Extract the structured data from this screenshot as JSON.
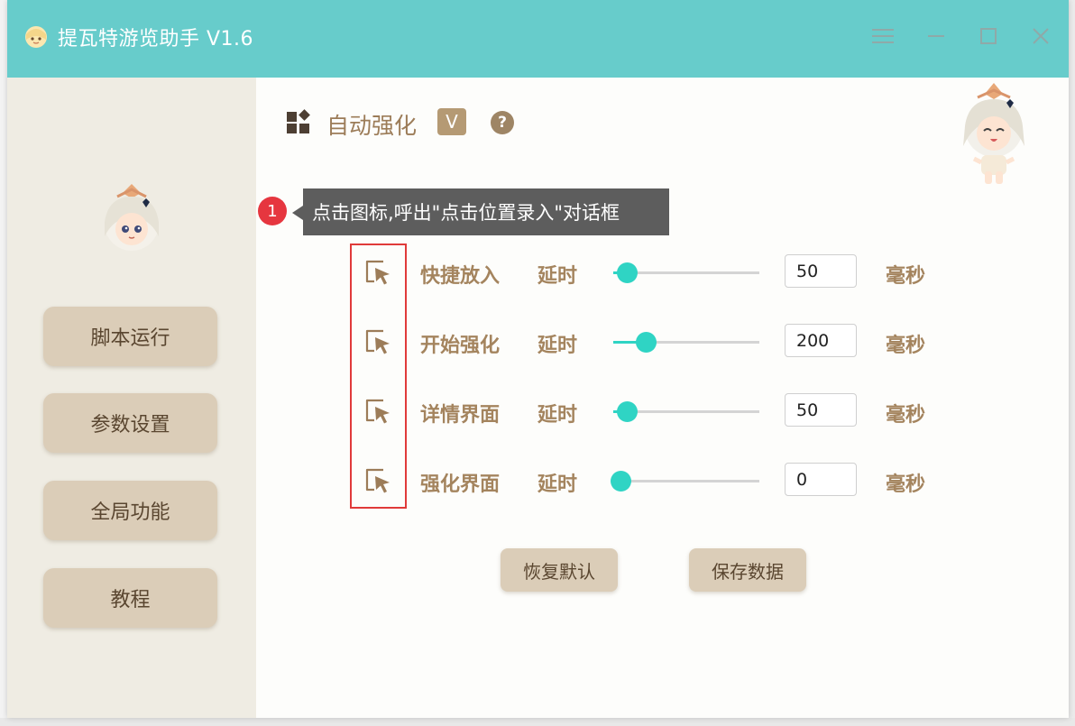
{
  "app": {
    "title": "提瓦特游览助手 V1.6",
    "accent_color": "#67cccb"
  },
  "window_controls": [
    "menu-icon",
    "minimize-icon",
    "maximize-icon",
    "close-icon"
  ],
  "sidebar": {
    "items": [
      {
        "label": "脚本运行"
      },
      {
        "label": "参数设置"
      },
      {
        "label": "全局功能"
      },
      {
        "label": "教程"
      }
    ]
  },
  "main": {
    "section_title": "自动强化",
    "badge": "V",
    "help": "?",
    "tip": {
      "number": "1",
      "text": "点击图标,呼出\"点击位置录入\"对话框"
    },
    "delay_label": "延时",
    "unit_label": "毫秒",
    "rows": [
      {
        "label": "快捷放入",
        "value": "50",
        "slider_fraction": 0.09
      },
      {
        "label": "开始强化",
        "value": "200",
        "slider_fraction": 0.22
      },
      {
        "label": "详情界面",
        "value": "50",
        "slider_fraction": 0.09
      },
      {
        "label": "强化界面",
        "value": "0",
        "slider_fraction": 0.05
      }
    ],
    "buttons": {
      "reset": "恢复默认",
      "save": "保存数据"
    }
  }
}
